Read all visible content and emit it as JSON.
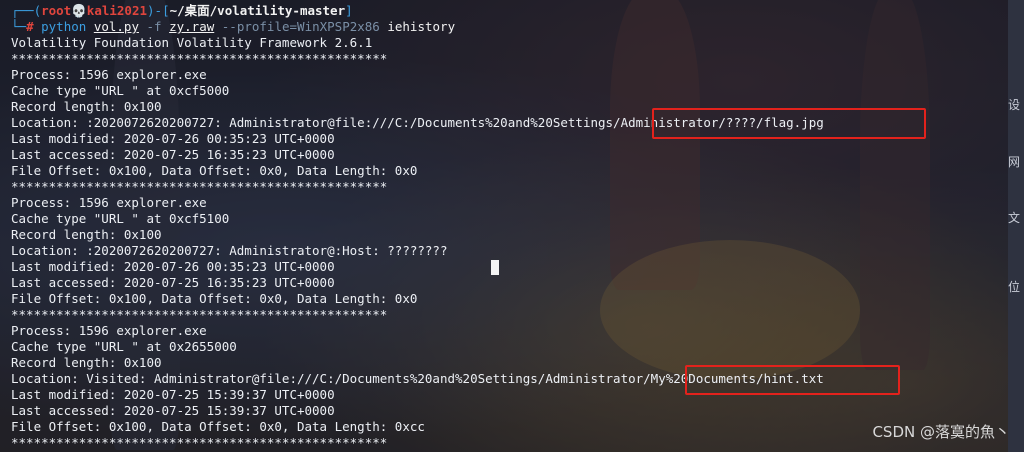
{
  "prompt": {
    "corner_top": "┌──(",
    "user": "root",
    "skull": "💀",
    "host": "kali2021",
    "close_paren": ")-[",
    "path": "~/桌面/volatility-master",
    "close_bracket": "]",
    "corner_bottom": "└─",
    "hash": "#",
    "cmd": "python",
    "script": "vol.py",
    "f_flag": "-f",
    "image": "zy.raw",
    "profile": "--profile=WinXPSP2x86",
    "plugin": "iehistory"
  },
  "output_lines": [
    "Volatility Foundation Volatility Framework 2.6.1",
    "**************************************************",
    "Process: 1596 explorer.exe",
    "Cache type \"URL \" at 0xcf5000",
    "Record length: 0x100",
    "Location: :2020072620200727: Administrator@file:///C:/Documents%20and%20Settings/Administrator/????/flag.jpg",
    "Last modified: 2020-07-26 00:35:23 UTC+0000",
    "Last accessed: 2020-07-25 16:35:23 UTC+0000",
    "File Offset: 0x100, Data Offset: 0x0, Data Length: 0x0",
    "**************************************************",
    "Process: 1596 explorer.exe",
    "Cache type \"URL \" at 0xcf5100",
    "Record length: 0x100",
    "Location: :2020072620200727: Administrator@:Host: ????????",
    "Last modified: 2020-07-26 00:35:23 UTC+0000",
    "Last accessed: 2020-07-25 16:35:23 UTC+0000",
    "File Offset: 0x100, Data Offset: 0x0, Data Length: 0x0",
    "**************************************************",
    "Process: 1596 explorer.exe",
    "Cache type \"URL \" at 0x2655000",
    "Record length: 0x100",
    "Location: Visited: Administrator@file:///C:/Documents%20and%20Settings/Administrator/My%20Documents/hint.txt",
    "Last modified: 2020-07-25 15:39:37 UTC+0000",
    "Last accessed: 2020-07-25 15:39:37 UTC+0000",
    "File Offset: 0x100, Data Offset: 0x0, Data Length: 0xcc",
    "**************************************************"
  ],
  "side_panel": [
    "设",
    "网",
    "文",
    "位"
  ],
  "watermark": "CSDN @落寞的魚丶",
  "colors": {
    "highlight_box": "#e3221c",
    "prompt_blue": "#3b9ee0",
    "prompt_red": "#e0453d"
  }
}
